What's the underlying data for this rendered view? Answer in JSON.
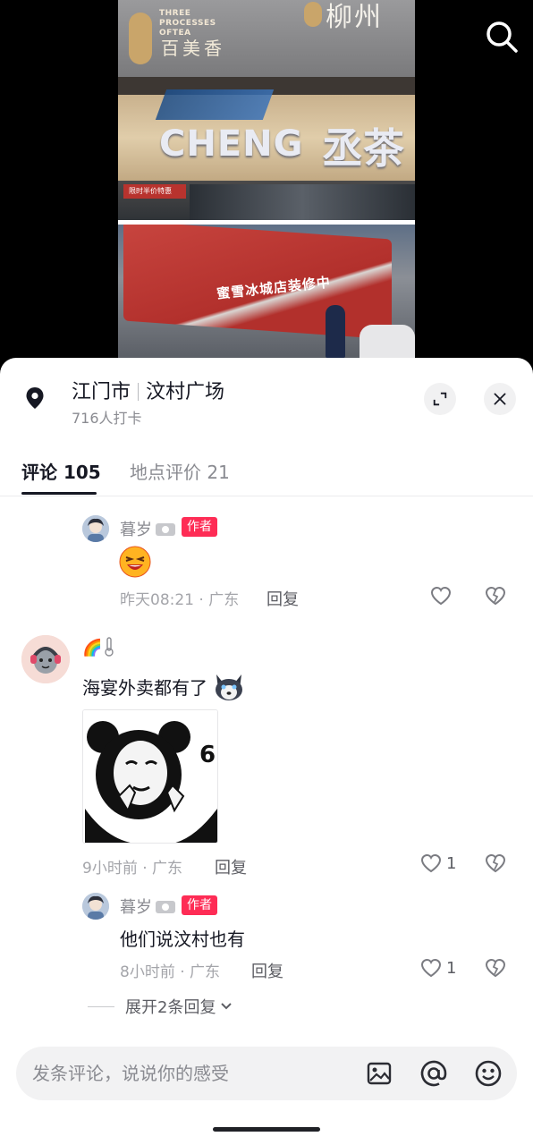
{
  "video": {
    "photo_top_sign_en": "THREE PROCESSES OFTEA",
    "photo_top_sign_cn": "百美香",
    "photo_top_sign_right": "柳州",
    "photo_top_store": "CHENG",
    "photo_top_store_cn": "丞茶",
    "photo_top_banner": "限时半价特惠",
    "photo_bottom_banner": "蜜雪冰城店装修中"
  },
  "location": {
    "city": "江门市",
    "place": "汶村广场",
    "checkins": "716人打卡"
  },
  "tabs": {
    "comments": "评论 105",
    "reviews": "地点评价 21"
  },
  "comments": [
    {
      "username": "暮岁",
      "badge": "作者",
      "time_location": "昨天08:21 · 广东",
      "reply_label": "回复"
    },
    {
      "username": "🌈",
      "text": "海宴外卖都有了",
      "sticker_number": "6",
      "time_location": "9小时前 · 广东",
      "reply_label": "回复",
      "likes": "1"
    },
    {
      "username": "暮岁",
      "badge": "作者",
      "text": "他们说汶村也有",
      "time_location": "8小时前 · 广东",
      "reply_label": "回复",
      "likes": "1"
    }
  ],
  "expand_replies": "展开2条回复",
  "input": {
    "placeholder": "发条评论，说说你的感受"
  },
  "icons": {
    "search": "search-icon",
    "pin": "location-pin-icon",
    "expand": "expand-icon",
    "close": "close-icon",
    "like": "heart-icon",
    "dislike": "broken-heart-icon",
    "image": "image-icon",
    "mention": "at-icon",
    "emoji": "emoji-icon"
  },
  "colors": {
    "accent": "#fe2c55",
    "text": "#161823",
    "muted": "#8a8b91"
  }
}
